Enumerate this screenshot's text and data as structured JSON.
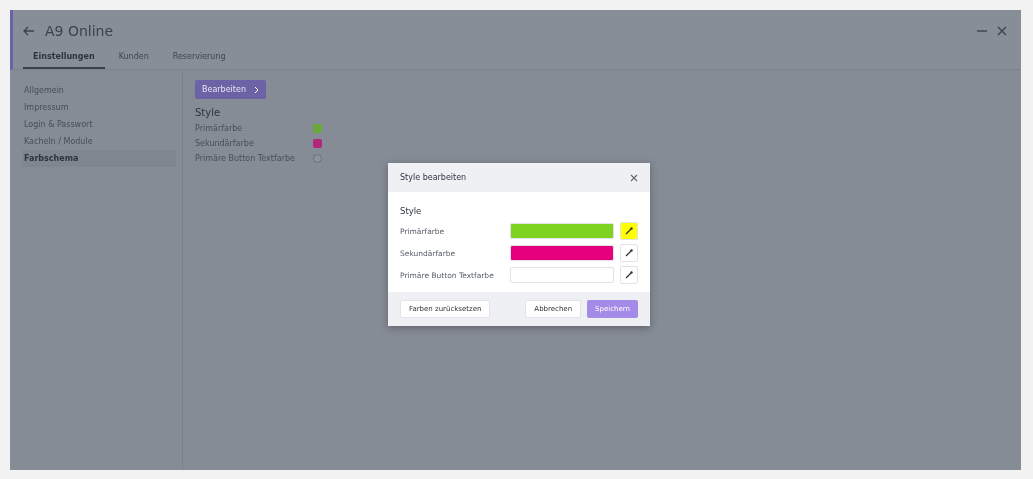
{
  "window": {
    "title": "A9 Online"
  },
  "tabs": [
    {
      "label": "Einstellungen",
      "selected": true
    },
    {
      "label": "Kunden",
      "selected": false
    },
    {
      "label": "Reservierung",
      "selected": false
    }
  ],
  "sidebar": {
    "items": [
      {
        "label": "Allgemein",
        "selected": false
      },
      {
        "label": "Impressum",
        "selected": false
      },
      {
        "label": "Login & Passwort",
        "selected": false
      },
      {
        "label": "Kacheln / Module",
        "selected": false
      },
      {
        "label": "Farbschema",
        "selected": true
      }
    ]
  },
  "content": {
    "edit_button": "Bearbeiten",
    "heading": "Style",
    "rows": [
      {
        "label": "Primärfarbe",
        "color": "#6aa83a"
      },
      {
        "label": "Sekundärfarbe",
        "color": "#b3267c"
      },
      {
        "label": "Primäre Button Textfarbe",
        "color": "#8e949e"
      }
    ]
  },
  "dialog": {
    "title": "Style bearbeiten",
    "heading": "Style",
    "rows": [
      {
        "label": "Primärfarbe",
        "color": "#7ed321",
        "picker_active": true
      },
      {
        "label": "Sekundärfarbe",
        "color": "#e6007e",
        "picker_active": false
      },
      {
        "label": "Primäre Button Textfarbe",
        "color": "#ffffff",
        "picker_active": false
      }
    ],
    "reset_button": "Farben zurücksetzen",
    "cancel_button": "Abbrechen",
    "save_button": "Speichern"
  }
}
